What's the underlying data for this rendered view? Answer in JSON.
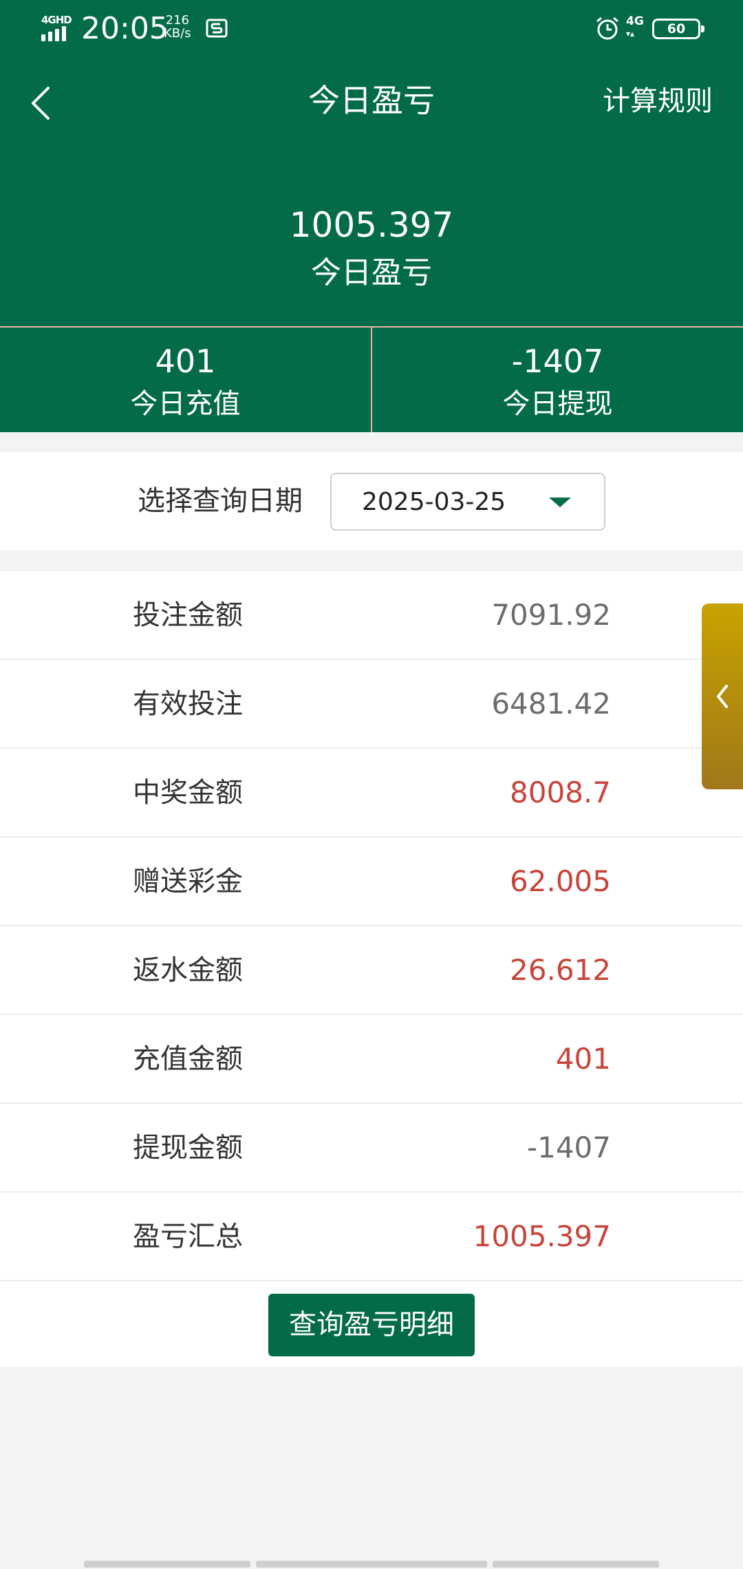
{
  "status_bar": {
    "network_left": "4GHD",
    "time": "20:05",
    "net_speed_value": "216",
    "net_speed_unit": "KB/s",
    "network_right": "4G",
    "battery": "60"
  },
  "header": {
    "title": "今日盈亏",
    "right_link": "计算规则"
  },
  "summary": {
    "profit_value": "1005.397",
    "profit_label": "今日盈亏"
  },
  "stats": [
    {
      "value": "401",
      "label": "今日充值"
    },
    {
      "value": "-1407",
      "label": "今日提现"
    }
  ],
  "date_filter": {
    "label": "选择查询日期",
    "value": "2025-03-25"
  },
  "rows": [
    {
      "label": "投注金额",
      "value": "7091.92",
      "color": "#6c6c6c"
    },
    {
      "label": "有效投注",
      "value": "6481.42",
      "color": "#6c6c6c"
    },
    {
      "label": "中奖金额",
      "value": "8008.7",
      "color": "#c8443a"
    },
    {
      "label": "赠送彩金",
      "value": "62.005",
      "color": "#c8443a"
    },
    {
      "label": "返水金额",
      "value": "26.612",
      "color": "#c8443a"
    },
    {
      "label": "充值金额",
      "value": "401",
      "color": "#c8443a"
    },
    {
      "label": "提现金额",
      "value": "-1407",
      "color": "#6c6c6c"
    },
    {
      "label": "盈亏汇总",
      "value": "1005.397",
      "color": "#c8443a"
    }
  ],
  "detail_button": "查询盈亏明细",
  "colors": {
    "brand_green": "#036b4a",
    "value_red": "#c8443a",
    "value_gray": "#6c6c6c",
    "side_tab_gold": "#c8a300"
  },
  "icons": [
    "back-icon",
    "side-tab-chevron-left-icon",
    "dropdown-caret-icon",
    "alarm-icon",
    "sim-s-icon"
  ]
}
